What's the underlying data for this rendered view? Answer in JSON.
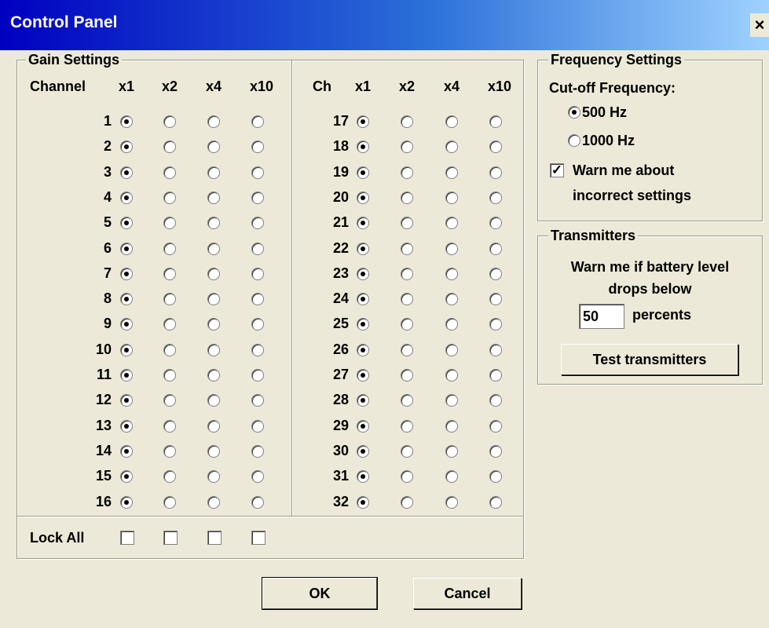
{
  "window": {
    "title": "Control Panel",
    "close_glyph": "×"
  },
  "gain": {
    "legend": "Gain Settings",
    "left_channel_header": "Channel",
    "right_channel_header": "Ch",
    "columns": [
      "x1",
      "x2",
      "x4",
      "x10"
    ],
    "left_channels": [
      "1",
      "2",
      "3",
      "4",
      "5",
      "6",
      "7",
      "8",
      "9",
      "10",
      "11",
      "12",
      "13",
      "14",
      "15",
      "16"
    ],
    "right_channels": [
      "17",
      "18",
      "19",
      "20",
      "21",
      "22",
      "23",
      "24",
      "25",
      "26",
      "27",
      "28",
      "29",
      "30",
      "31",
      "32"
    ],
    "selected_column": "x1",
    "lock_all_label": "Lock All"
  },
  "frequency": {
    "legend": "Frequency Settings",
    "cutoff_label": "Cut-off Frequency:",
    "options": [
      "500 Hz",
      "1000 Hz"
    ],
    "selected": "500 Hz",
    "warn_line1": "Warn me about",
    "warn_line2": "incorrect settings",
    "warn_checked": true
  },
  "transmitters": {
    "legend": "Transmitters",
    "line1": "Warn me if battery level",
    "line2": "drops below",
    "battery_value": "50",
    "unit": "percents",
    "test_button": "Test transmitters"
  },
  "buttons": {
    "ok": "OK",
    "cancel": "Cancel"
  }
}
